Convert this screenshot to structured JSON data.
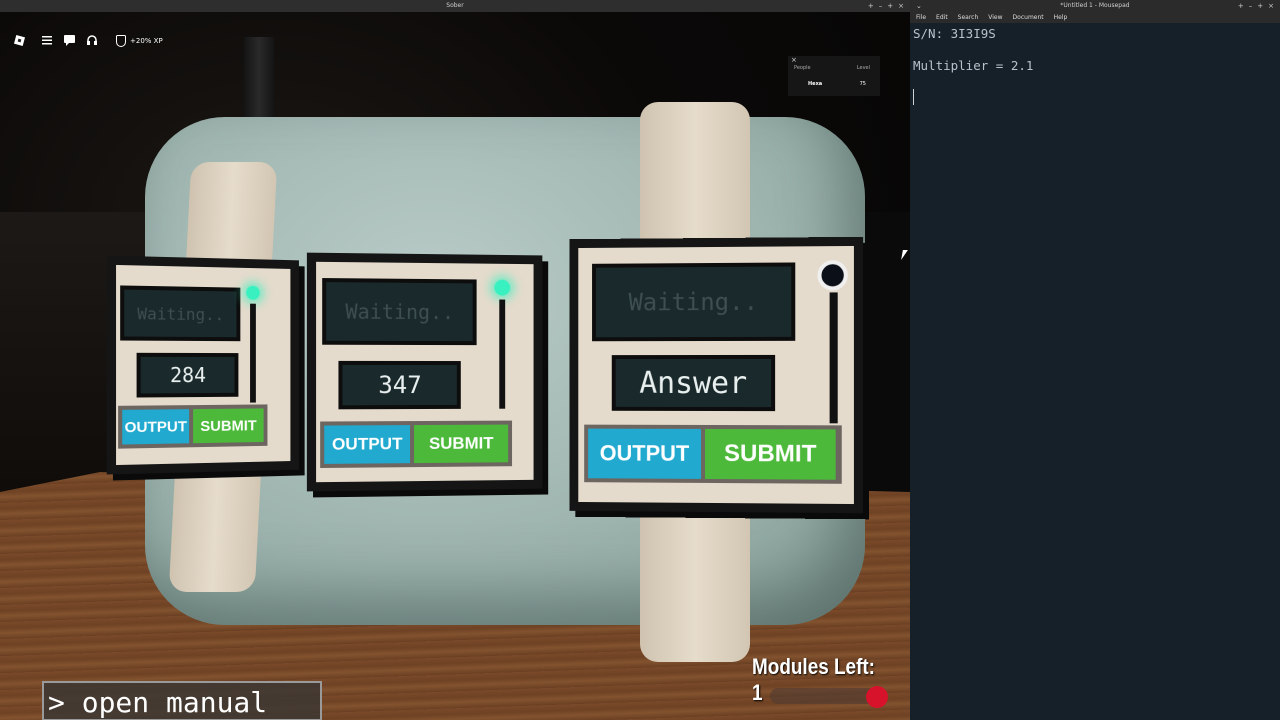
{
  "sober": {
    "title": "Sober",
    "controls": [
      "+",
      "–",
      "+",
      "×"
    ]
  },
  "hud": {
    "logo_icon": "roblox-logo-icon",
    "menu_icon": "menu-icon",
    "chat_icon": "chat-icon",
    "voice_icon": "headset-icon",
    "xp_label": "+20% XP"
  },
  "players_panel": {
    "close": "×",
    "header_people": "People",
    "header_level": "Level",
    "player_name": "Hexa",
    "player_level": "75"
  },
  "modules": [
    {
      "screen": "Waiting..",
      "number": "284",
      "output": "OUTPUT",
      "submit": "SUBMIT",
      "led": "on"
    },
    {
      "screen": "Waiting..",
      "number": "347",
      "output": "OUTPUT",
      "submit": "SUBMIT",
      "led": "on"
    },
    {
      "screen": "Waiting..",
      "number": "Answer",
      "output": "OUTPUT",
      "submit": "SUBMIT",
      "led": "off"
    }
  ],
  "status": {
    "modules_left": "Modules Left: 1"
  },
  "chat": {
    "text": "> open manual"
  },
  "mousepad": {
    "title": "*Untitled 1 - Mousepad",
    "controls": [
      "+",
      "–",
      "+",
      "×"
    ],
    "menu": [
      "File",
      "Edit",
      "Search",
      "View",
      "Document",
      "Help"
    ],
    "lines": [
      "S/N: 3I3I9S",
      "",
      "Multiplier = 2.1",
      ""
    ]
  },
  "colors": {
    "output_button": "#21a9cf",
    "submit_button": "#4cb93a",
    "led_active": "#39f0c0",
    "timer_dot": "#d6132a"
  }
}
